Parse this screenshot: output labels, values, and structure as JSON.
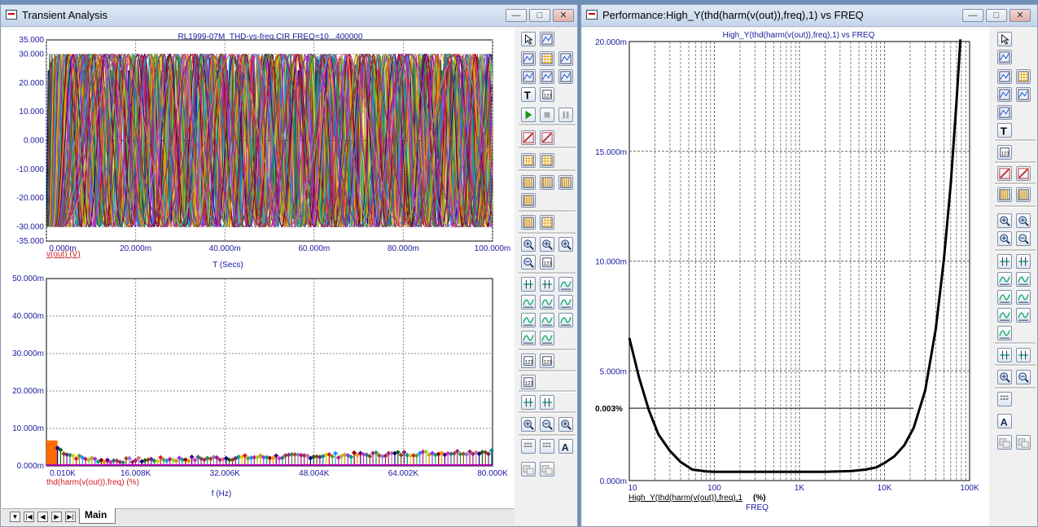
{
  "left_window": {
    "title": "Transient Analysis",
    "top_plot": {
      "title": "RL1999-07M_THD-vs-freq.CIR FREQ=10...400000",
      "y_ticks": [
        "35.000",
        "30.000",
        "20.000",
        "10.000",
        "0.000",
        "-10.000",
        "-20.000",
        "-30.000",
        "-35.000"
      ],
      "x_ticks": [
        "0.000m",
        "20.000m",
        "40.000m",
        "60.000m",
        "80.000m",
        "100.000m"
      ],
      "trace_label": "v(out) (V)",
      "x_axis_label": "T (Secs)"
    },
    "bottom_plot": {
      "y_ticks": [
        "50.000m",
        "40.000m",
        "30.000m",
        "20.000m",
        "10.000m",
        "0.000m"
      ],
      "x_ticks": [
        "0.010K",
        "16.008K",
        "32.006K",
        "48.004K",
        "64.002K",
        "80.000K"
      ],
      "trace_label": "thd(harm(v(out)),freq) (%)",
      "x_axis_label": "f (Hz)"
    },
    "tab_label": "Main"
  },
  "right_window": {
    "title": "Performance:High_Y(thd(harm(v(out)),freq),1) vs FREQ",
    "plot_title": "High_Y(thd(harm(v(out)),freq),1) vs FREQ",
    "y_ticks": [
      "20.000m",
      "15.000m",
      "10.000m",
      "5.000m",
      "0.000m"
    ],
    "x_ticks": [
      "10",
      "100",
      "1K",
      "10K",
      "100K"
    ],
    "marker_label": "0.003%",
    "trace_label": "High_Y(thd(harm(v(out)),freq),1",
    "trace_unit": "(%)",
    "x_axis_label": "FREQ"
  },
  "chart_data": [
    {
      "type": "line",
      "title": "RL1999-07M_THD-vs-freq.CIR FREQ=10...400000",
      "xlabel": "T (Secs)",
      "ylabel": "v(out) (V)",
      "xlim": [
        0,
        0.1
      ],
      "ylim": [
        -35,
        35
      ],
      "amplitude": 30,
      "series_periods_ms": [
        1,
        1.2,
        1.4,
        1.6,
        1.8,
        2,
        2.2,
        2.5,
        2.8,
        3.1,
        3.5,
        4,
        4.5,
        5,
        5.7,
        6.4,
        7.2,
        8.1,
        9.2,
        10.4,
        11.8,
        13.4,
        15.2,
        17.3,
        19.6,
        22.2,
        25.2
      ],
      "colors": [
        "#00008b",
        "#1a5f1a",
        "#8b4513",
        "#7a1f7a",
        "#008b8b",
        "#e6c800",
        "#d32020",
        "#6a9a2a",
        "#1e90ff",
        "#c71585",
        "#9acd32",
        "#c8a000",
        "#9b30ff",
        "#00a86b",
        "#8b0000",
        "#ff8c00",
        "#4b0082",
        "#d030c0",
        "#3a6a8a",
        "#7a5230",
        "#b0207a",
        "#2e8b57",
        "#a05010",
        "#9370db",
        "#a0205a",
        "#8a2a8a",
        "#e06a7a"
      ]
    },
    {
      "type": "scatter",
      "xlabel": "f (Hz)",
      "ylabel": "thd(harm(v(out)),freq) (%)",
      "xlim": [
        10,
        80000
      ],
      "ylim": [
        0,
        0.05
      ],
      "note_values": "values near 0.003 %, starting at about 0.007 % below 2 kHz"
    },
    {
      "type": "line",
      "title": "High_Y(thd(harm(v(out)),freq),1) vs FREQ",
      "xlabel": "FREQ",
      "ylabel": "High_Y(thd(harm(v(out)),freq),1 (%)",
      "xscale": "log",
      "xlim": [
        10,
        100000
      ],
      "ylim": [
        0,
        0.02
      ],
      "x": [
        10,
        13,
        17,
        22,
        30,
        40,
        55,
        80,
        100,
        200,
        500,
        1000,
        2000,
        4000,
        6000,
        8000,
        10000,
        13000,
        17000,
        22000,
        30000,
        40000,
        50000,
        60000,
        70000,
        78000
      ],
      "y": [
        0.0065,
        0.0047,
        0.0032,
        0.0021,
        0.00135,
        0.00085,
        0.0005,
        0.00042,
        0.0004,
        0.0004,
        0.0004,
        0.0004,
        0.0004,
        0.00043,
        0.0005,
        0.0006,
        0.0008,
        0.0011,
        0.0016,
        0.0024,
        0.0041,
        0.0069,
        0.0101,
        0.0135,
        0.0172,
        0.0201
      ],
      "marker_y": 0.0033
    }
  ]
}
